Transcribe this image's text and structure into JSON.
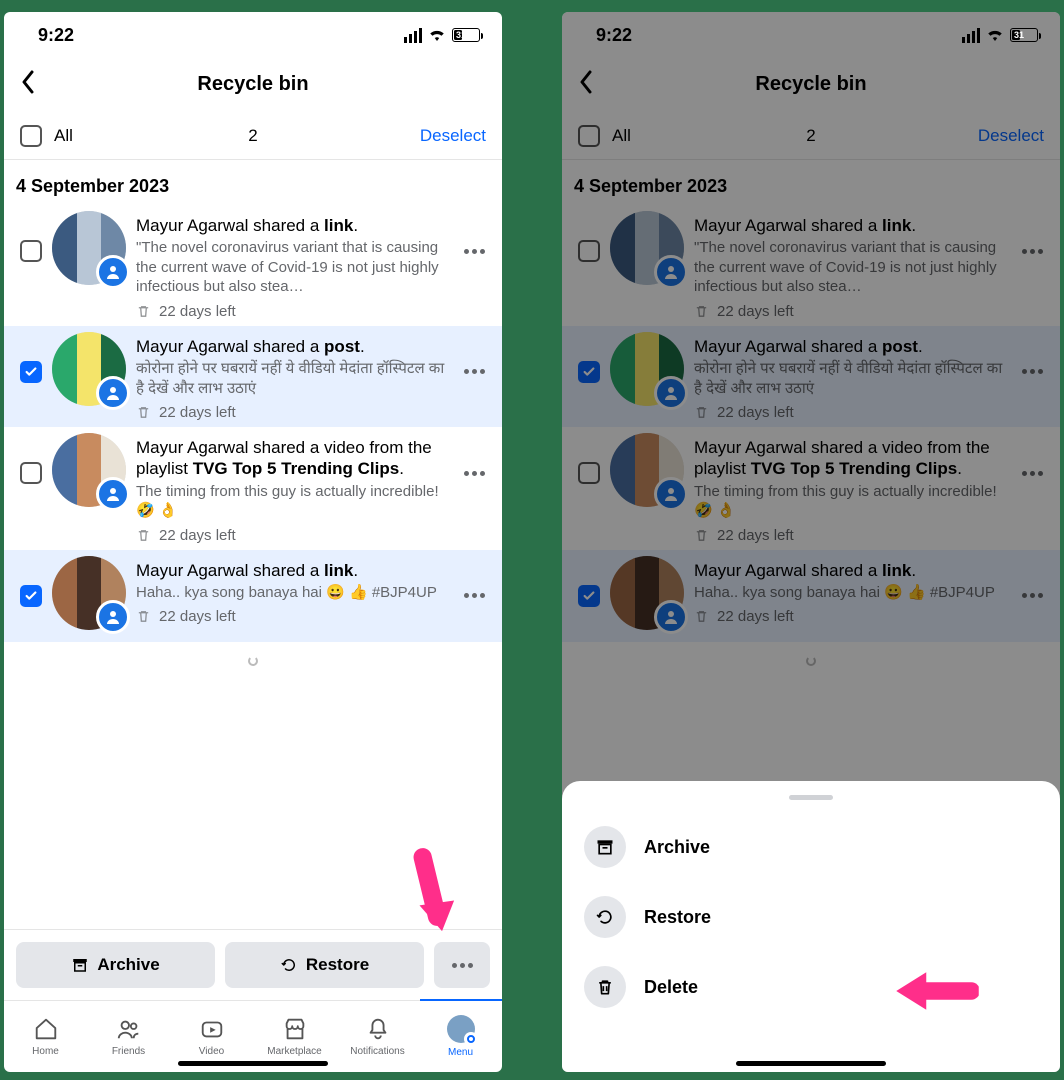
{
  "status": {
    "time": "9:22",
    "battery": "31"
  },
  "header": {
    "title": "Recycle bin"
  },
  "selectRow": {
    "all": "All",
    "count": "2",
    "deselect": "Deselect"
  },
  "dateHeader": "4 September 2023",
  "items": [
    {
      "selected": false,
      "titlePrefix": "Mayur Agarwal shared a ",
      "titleBold": "link",
      "titleSuffix": ".",
      "desc": "\"The novel coronavirus variant that is causing the current wave of Covid-19 is not just highly infectious but also stea…",
      "meta": "22 days left"
    },
    {
      "selected": true,
      "titlePrefix": "Mayur Agarwal shared a ",
      "titleBold": "post",
      "titleSuffix": ".",
      "desc": "कोरोना होने पर घबरायें नहीं ये वीडियो मेदांता हॉस्पिटल का है   देखें और लाभ उठाएं",
      "meta": "22 days left"
    },
    {
      "selected": false,
      "titlePrefix": "Mayur Agarwal shared a video from the playlist ",
      "titleBold": "TVG Top 5 Trending Clips",
      "titleSuffix": ".",
      "desc": "The timing from this guy is actually incredible! 🤣 👌",
      "meta": "22 days left"
    },
    {
      "selected": true,
      "titlePrefix": "Mayur Agarwal shared a ",
      "titleBold": "link",
      "titleSuffix": ".",
      "desc": "Haha.. kya song banaya hai 😀 👍 #BJP4UP",
      "meta": "22 days left"
    }
  ],
  "thumbColors": [
    [
      "#3b5a80",
      "#b8c6d6",
      "#6e88a6"
    ],
    [
      "#2aa86b",
      "#f4e46a",
      "#1b6b43"
    ],
    [
      "#4a6ea0",
      "#c88b5f",
      "#e9e2d6"
    ],
    [
      "#9c6644",
      "#463026",
      "#b0825e"
    ]
  ],
  "actions": {
    "archive": "Archive",
    "restore": "Restore"
  },
  "tabs": {
    "home": "Home",
    "friends": "Friends",
    "video": "Video",
    "marketplace": "Marketplace",
    "notifications": "Notifications",
    "menu": "Menu"
  },
  "sheet": {
    "archive": "Archive",
    "restore": "Restore",
    "delete": "Delete"
  },
  "arrowColor": "#ff2e8a"
}
